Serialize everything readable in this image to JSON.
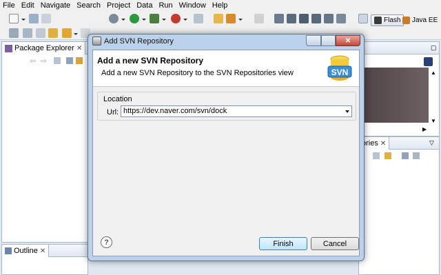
{
  "menu": [
    "File",
    "Edit",
    "Navigate",
    "Search",
    "Project",
    "Data",
    "Run",
    "Window",
    "Help"
  ],
  "perspectives": [
    {
      "label": "Flash",
      "icon": "flash-perspective-icon",
      "selected": true
    },
    {
      "label": "Java EE",
      "icon": "javaee-perspective-icon",
      "selected": false
    }
  ],
  "views": {
    "package_explorer": "Package Explorer",
    "outline": "Outline",
    "repositories_partial": "ories"
  },
  "dialog": {
    "title": "Add SVN Repository",
    "heading": "Add a new SVN Repository",
    "description": "Add a new SVN Repository to the SVN Repositories view",
    "logo_text": "SVN",
    "location_label": "Location",
    "url_label": "Url:",
    "url_value": "https://dev.naver.com/svn/dock",
    "help_glyph": "?",
    "finish_label": "Finish",
    "cancel_label": "Cancel"
  },
  "colors": {
    "accent": "#3c7fb1",
    "dialog_frame": "#bcd2ea",
    "svn_logo": "#3b8fd6"
  }
}
